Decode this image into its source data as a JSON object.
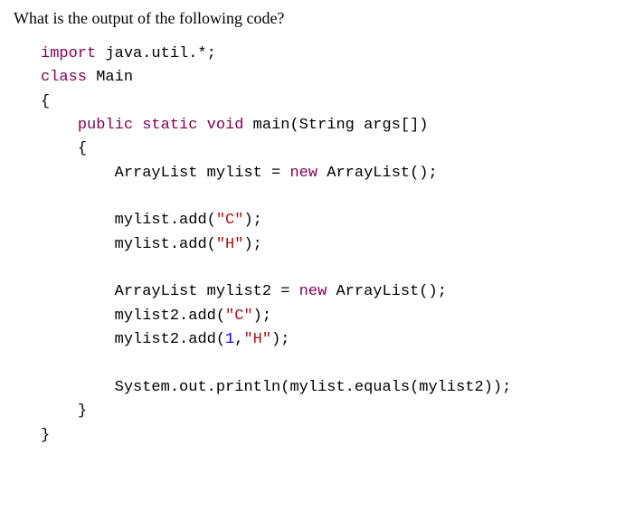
{
  "question": "What is the output of the following code?",
  "code": {
    "kw_import": "import",
    "import_rest": " java.util.*;",
    "kw_class": "class",
    "class_rest": " Main",
    "brace_open": "{",
    "kw_public": "public",
    "kw_static": "static",
    "kw_void": "void",
    "main_sig": " main(String args[])",
    "inner_open": "{",
    "line1a": "ArrayList mylist = ",
    "kw_new1": "new",
    "line1b": " ArrayList();",
    "line2a": "mylist.add(",
    "str_c1": "\"C\"",
    "line2b": ");",
    "line3a": "mylist.add(",
    "str_h1": "\"H\"",
    "line3b": ");",
    "line4a": "ArrayList mylist2 = ",
    "kw_new2": "new",
    "line4b": " ArrayList();",
    "line5a": "mylist2.add(",
    "str_c2": "\"C\"",
    "line5b": ");",
    "line6a": "mylist2.add(",
    "num1": "1",
    "line6b": ",",
    "str_h2": "\"H\"",
    "line6c": ");",
    "line7": "System.out.println(mylist.equals(mylist2));",
    "inner_close": "}",
    "brace_close": "}"
  }
}
